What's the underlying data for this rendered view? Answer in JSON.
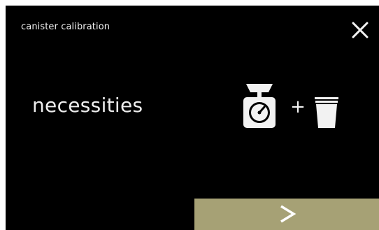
{
  "header": {
    "title": "canister calibration",
    "close_icon": "close-icon"
  },
  "main": {
    "headline": "necessities",
    "icons": [
      "scale-icon",
      "cup-icon"
    ],
    "plus": "+"
  },
  "footer": {
    "next_icon": "chevron-right-icon",
    "accent_color": "#a6a175"
  }
}
